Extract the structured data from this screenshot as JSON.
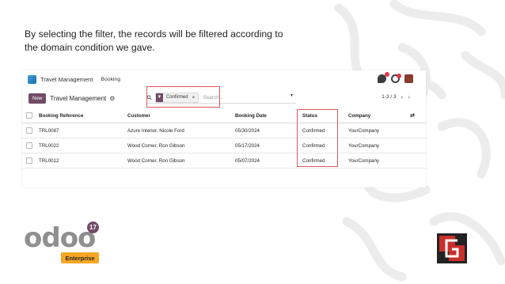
{
  "caption": {
    "line1": "By selecting the filter, the records will be filtered according to",
    "line2": "the domain condition we gave."
  },
  "navbar": {
    "app_title": "Travel Management",
    "menu_item": "Booking"
  },
  "control_panel": {
    "new_label": "New",
    "title": "Travel Management",
    "search": {
      "facet_label": "Confirmed",
      "facet_close": "×",
      "placeholder": "Search..."
    },
    "pager": "1-3 / 3"
  },
  "table": {
    "headers": {
      "ref": "Booking Reference",
      "customer": "Customer",
      "date": "Booking Date",
      "status": "Status",
      "company": "Company"
    },
    "rows": [
      {
        "ref": "TRL0087",
        "customer": "Azure Interior, Nicole Ford",
        "date": "05/30/2024",
        "status": "Confirmed",
        "company": "YourCompany"
      },
      {
        "ref": "TRL0022",
        "customer": "Wood Corner, Ron Gibson",
        "date": "05/17/2024",
        "status": "Confirmed",
        "company": "YourCompany"
      },
      {
        "ref": "TRL0012",
        "customer": "Wood Corner, Ron Gibson",
        "date": "05/07/2024",
        "status": "Confirmed",
        "company": "YourCompany"
      }
    ]
  },
  "logo": {
    "text": "odoo",
    "version": "17",
    "edition": "Enterprise"
  },
  "colors": {
    "odoo_purple": "#714b67",
    "highlight_red": "#e0585b",
    "enterprise_orange": "#f5a623"
  }
}
